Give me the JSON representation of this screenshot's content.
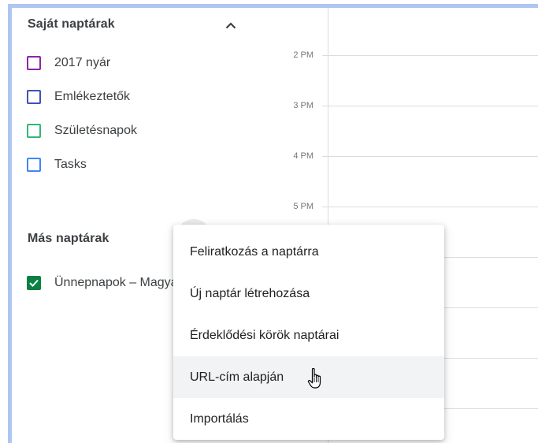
{
  "sidebar": {
    "own_calendars_header": "Saját naptárak",
    "own_calendars": [
      {
        "label": "2017 nyár",
        "color": "#8e24aa",
        "checked": false
      },
      {
        "label": "Emlékeztetők",
        "color": "#3f51b5",
        "checked": false
      },
      {
        "label": "Születésnapok",
        "color": "#33b679",
        "checked": false
      },
      {
        "label": "Tasks",
        "color": "#4285f4",
        "checked": false
      }
    ],
    "other_calendars_header": "Más naptárak",
    "other_calendars": [
      {
        "label": "Ünnepnapok – Magyarország",
        "color": "#0b8043",
        "checked": true
      }
    ]
  },
  "time_grid": {
    "labels": [
      "2 PM",
      "3 PM",
      "4 PM",
      "5 PM"
    ]
  },
  "menu": {
    "items": [
      {
        "label": "Feliratkozás a naptárra"
      },
      {
        "label": "Új naptár létrehozása"
      },
      {
        "label": "Érdeklődési körök naptárai"
      },
      {
        "label": "URL-cím alapján"
      },
      {
        "label": "Importálás"
      }
    ],
    "hovered_index": 3
  },
  "icons": {
    "collapse": "chevron-up-icon",
    "cursor": "hand-pointer-icon",
    "check": "check-icon"
  }
}
